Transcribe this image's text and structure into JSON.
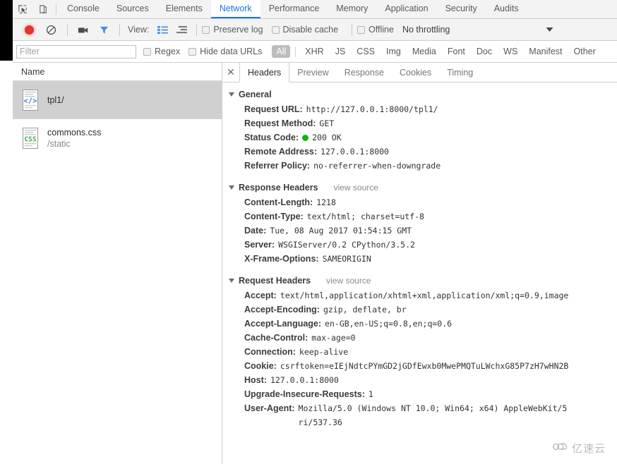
{
  "panel_tabs": [
    {
      "label": "Console",
      "active": false
    },
    {
      "label": "Sources",
      "active": false
    },
    {
      "label": "Elements",
      "active": false
    },
    {
      "label": "Network",
      "active": true
    },
    {
      "label": "Performance",
      "active": false
    },
    {
      "label": "Memory",
      "active": false
    },
    {
      "label": "Application",
      "active": false
    },
    {
      "label": "Security",
      "active": false
    },
    {
      "label": "Audits",
      "active": false
    }
  ],
  "inspect_icons": [
    {
      "name": "inspect-element-icon"
    },
    {
      "name": "device-toolbar-icon"
    }
  ],
  "toolbar": {
    "record_icon": "record-dot-icon",
    "clear_icon": "clear-icon",
    "capture_screenshots_icon": "camera-icon",
    "filter_icon": "funnel-icon",
    "view_label": "View:",
    "view_list_icon": "list-view-icon",
    "view_waterfall_icon": "waterfall-view-icon",
    "preserve_log": "Preserve log",
    "disable_cache": "Disable cache",
    "offline": "Offline",
    "throttling": "No throttling",
    "throttling_caret_icon": "chevron-down-icon"
  },
  "filter_bar": {
    "placeholder": "Filter",
    "value": "",
    "regex_label": "Regex",
    "hide_data_urls_label": "Hide data URLs",
    "types": [
      {
        "label": "All",
        "active": true
      },
      {
        "label": "XHR",
        "active": false
      },
      {
        "label": "JS",
        "active": false
      },
      {
        "label": "CSS",
        "active": false
      },
      {
        "label": "Img",
        "active": false
      },
      {
        "label": "Media",
        "active": false
      },
      {
        "label": "Font",
        "active": false
      },
      {
        "label": "Doc",
        "active": false
      },
      {
        "label": "WS",
        "active": false
      },
      {
        "label": "Manifest",
        "active": false
      },
      {
        "label": "Other",
        "active": false
      }
    ]
  },
  "request_list": {
    "column_header": "Name",
    "rows": [
      {
        "name": "tpl1/",
        "sub": "",
        "icon": "html-document-icon",
        "selected": true
      },
      {
        "name": "commons.css",
        "sub": "/static",
        "icon": "css-document-icon",
        "selected": false
      }
    ]
  },
  "detail_tabs": [
    {
      "label": "Headers",
      "active": true
    },
    {
      "label": "Preview",
      "active": false
    },
    {
      "label": "Response",
      "active": false
    },
    {
      "label": "Cookies",
      "active": false
    },
    {
      "label": "Timing",
      "active": false
    }
  ],
  "close_icon_glyph": "✕",
  "sections": {
    "general": {
      "title": "General",
      "rows": [
        {
          "key": "Request URL:",
          "value": "http://127.0.0.1:8000/tpl1/"
        },
        {
          "key": "Request Method:",
          "value": "GET"
        },
        {
          "key": "Status Code:",
          "value": "200 OK",
          "status_dot": true
        },
        {
          "key": "Remote Address:",
          "value": "127.0.0.1:8000"
        },
        {
          "key": "Referrer Policy:",
          "value": "no-referrer-when-downgrade"
        }
      ]
    },
    "response_headers": {
      "title": "Response Headers",
      "view_source": "view source",
      "rows": [
        {
          "key": "Content-Length:",
          "value": "1218"
        },
        {
          "key": "Content-Type:",
          "value": "text/html; charset=utf-8"
        },
        {
          "key": "Date:",
          "value": "Tue, 08 Aug 2017 01:54:15 GMT"
        },
        {
          "key": "Server:",
          "value": "WSGIServer/0.2 CPython/3.5.2"
        },
        {
          "key": "X-Frame-Options:",
          "value": "SAMEORIGIN"
        }
      ]
    },
    "request_headers": {
      "title": "Request Headers",
      "view_source": "view source",
      "rows": [
        {
          "key": "Accept:",
          "value": "text/html,application/xhtml+xml,application/xml;q=0.9,image"
        },
        {
          "key": "Accept-Encoding:",
          "value": "gzip, deflate, br"
        },
        {
          "key": "Accept-Language:",
          "value": "en-GB,en-US;q=0.8,en;q=0.6"
        },
        {
          "key": "Cache-Control:",
          "value": "max-age=0"
        },
        {
          "key": "Connection:",
          "value": "keep-alive"
        },
        {
          "key": "Cookie:",
          "value": "csrftoken=eIEjNdtcPYmGD2jGDfEwxb0MwePMQTuLWchxG85P7zH7wHN2B"
        },
        {
          "key": "Host:",
          "value": "127.0.0.1:8000"
        },
        {
          "key": "Upgrade-Insecure-Requests:",
          "value": "1"
        },
        {
          "key": "User-Agent:",
          "value": "Mozilla/5.0 (Windows NT 10.0; Win64; x64) AppleWebKit/5\nri/537.36"
        }
      ]
    }
  },
  "watermark": {
    "icon": "cloud-icon",
    "text": "亿速云"
  },
  "colors": {
    "accent": "#1a73e8",
    "record": "#e8322a",
    "status_ok": "#0fb50f",
    "toolbar_bg": "#f3f3f3",
    "selected_row": "#d0d0d0"
  }
}
